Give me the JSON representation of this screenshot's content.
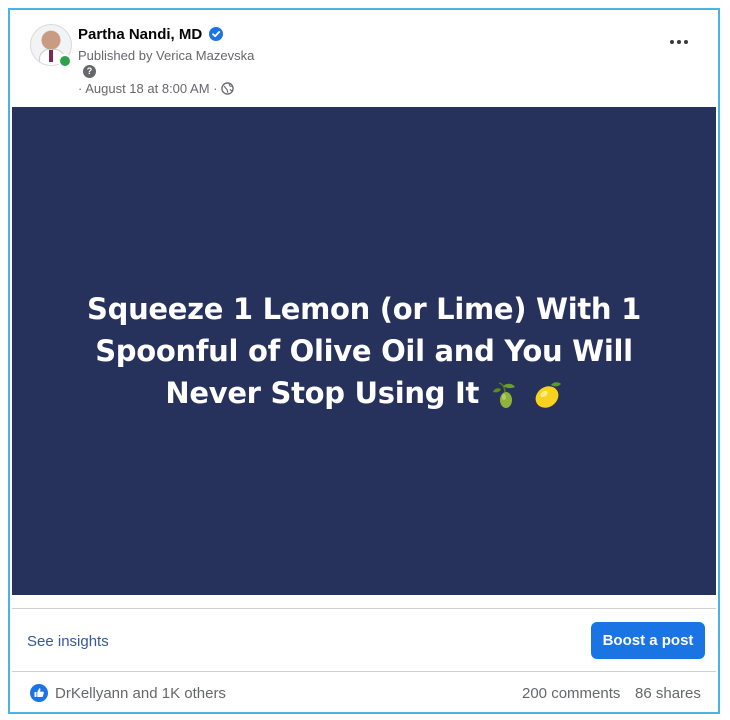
{
  "post": {
    "author": {
      "name": "Partha Nandi, MD",
      "published_by": "Published by Verica Mazevska",
      "help_glyph": "?",
      "meta": "· August 18 at 8:00 AM ·",
      "verified_icon": "verified-badge-icon",
      "audience_icon": "globe-icon",
      "online_status_color": "#31a24c"
    },
    "image": {
      "background_color": "#27325c",
      "headline": "Squeeze 1 Lemon (or Lime) With 1 Spoonful of Olive Oil and You Will Never Stop Using It",
      "emojis": [
        "olive-icon",
        "lemon-icon"
      ]
    },
    "actions": {
      "insights_label": "See insights",
      "boost_label": "Boost a post",
      "boost_color": "#1b74e4"
    },
    "engagement": {
      "reactions": "DrKellyann and 1K others",
      "comments": "200 comments",
      "shares": "86 shares",
      "reaction_icon": "like-icon"
    }
  },
  "colors": {
    "frame_border": "#4ab3e6",
    "secondary_text": "#65676b",
    "link": "#385898"
  }
}
